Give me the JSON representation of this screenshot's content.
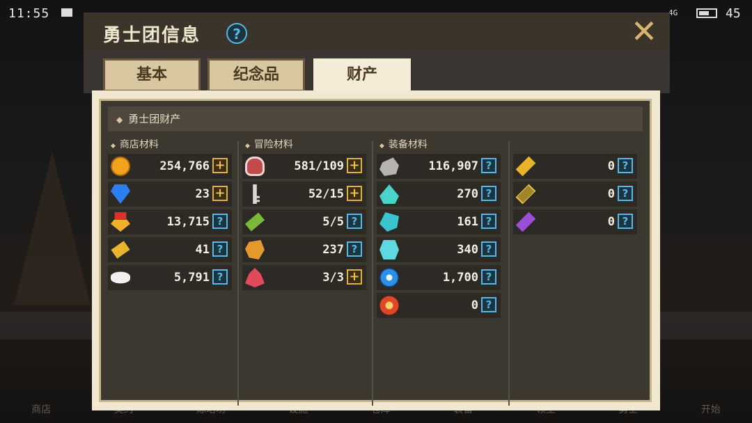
{
  "status_bar": {
    "time": "11:55",
    "network": "4G",
    "battery": "45"
  },
  "dialog": {
    "title": "勇士团信息",
    "tabs": [
      {
        "label": "基本",
        "active": false
      },
      {
        "label": "纪念品",
        "active": false
      },
      {
        "label": "财产",
        "active": true
      }
    ],
    "section_title": "勇士团财产",
    "columns": [
      {
        "title": "商店材料",
        "items": [
          {
            "icon": "gold-coin-icon",
            "value": "254,766",
            "action": "plus"
          },
          {
            "icon": "blue-gem-icon",
            "value": "23",
            "action": "plus"
          },
          {
            "icon": "medal-icon",
            "value": "13,715",
            "action": "help"
          },
          {
            "icon": "gold-ticket-icon",
            "value": "41",
            "action": "help"
          },
          {
            "icon": "fish-bone-icon",
            "value": "5,791",
            "action": "help"
          }
        ]
      },
      {
        "title": "冒险材料",
        "items": [
          {
            "icon": "meat-icon",
            "value": "581/109",
            "action": "plus"
          },
          {
            "icon": "key-icon",
            "value": "52/15",
            "action": "plus"
          },
          {
            "icon": "green-scroll-icon",
            "value": "5/5",
            "action": "help"
          },
          {
            "icon": "orange-ore-icon",
            "value": "237",
            "action": "help"
          },
          {
            "icon": "red-crystal-icon",
            "value": "3/3",
            "action": "plus"
          }
        ]
      },
      {
        "title": "装备材料",
        "items": [
          {
            "icon": "iron-stone-icon",
            "value": "116,907",
            "action": "help"
          },
          {
            "icon": "aqua-shard-icon",
            "value": "270",
            "action": "help"
          },
          {
            "icon": "teal-crystal-icon",
            "value": "161",
            "action": "help"
          },
          {
            "icon": "cyan-block-icon",
            "value": "340",
            "action": "help"
          },
          {
            "icon": "blue-orb-icon",
            "value": "1,700",
            "action": "help"
          },
          {
            "icon": "fire-orb-icon",
            "value": "0",
            "action": "help"
          }
        ]
      },
      {
        "title": "",
        "items": [
          {
            "icon": "gold-ticket-large-icon",
            "value": "0",
            "action": "help"
          },
          {
            "icon": "dark-ticket-icon",
            "value": "0",
            "action": "help"
          },
          {
            "icon": "purple-ticket-icon",
            "value": "0",
            "action": "help"
          }
        ]
      }
    ]
  },
  "bottom_nav": [
    "商店",
    "契约",
    "炼培坊",
    "设施",
    "仓库",
    "装备",
    "领主",
    "勇士",
    "开始"
  ],
  "colors": {
    "accent_help": "#58b8e6",
    "accent_plus": "#f0c040",
    "panel_bg": "#3d382f",
    "frame": "#f2e8d2"
  }
}
